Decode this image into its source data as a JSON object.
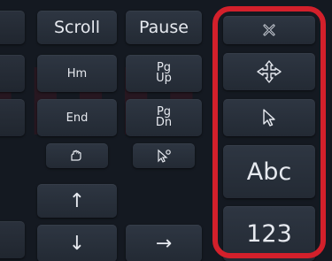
{
  "keyboard": {
    "scroll_label": "Scroll",
    "pause_label": "Pause",
    "home_label": "Hm",
    "pgup_label_1": "Pg",
    "pgup_label_2": "Up",
    "end_label": "End",
    "pgdn_label_1": "Pg",
    "pgdn_label_2": "Dn",
    "up_arrow": "↑",
    "down_arrow": "↓",
    "right_arrow": "→"
  },
  "side_panel": {
    "close_icon": "close-icon",
    "move_icon": "move-arrows-icon",
    "pointer_icon": "cursor-pointer-icon",
    "text_mode_label": "Abc",
    "number_mode_label": "123",
    "highlight_color": "#d3202b"
  },
  "colors": {
    "background": "#141921",
    "key": "#2b323d",
    "text": "#e6e9ef"
  }
}
